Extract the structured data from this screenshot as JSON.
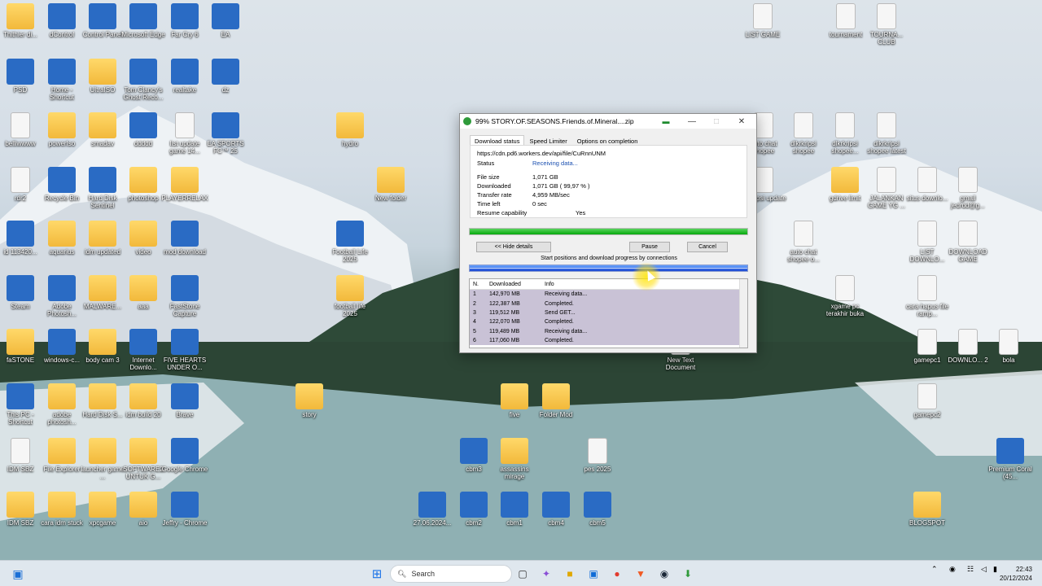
{
  "desktop_icons": [
    {
      "label": "Thithier di...",
      "kind": "folder",
      "icon": "folder-icon"
    },
    {
      "label": "dControl",
      "kind": "app",
      "icon": "app-icon"
    },
    {
      "label": "Control Panel",
      "kind": "app",
      "icon": "control-panel-icon"
    },
    {
      "label": "Microsoft Edge",
      "kind": "app",
      "icon": "edge-icon"
    },
    {
      "label": "Far Cry 6",
      "kind": "app",
      "icon": "game-icon"
    },
    {
      "label": "EA",
      "kind": "app",
      "icon": "ea-icon"
    },
    {
      "label": "LIST GAME",
      "kind": "file",
      "icon": "excel-icon"
    },
    {
      "label": "tournament",
      "kind": "file",
      "icon": "file-icon"
    },
    {
      "label": "TOURNA... CLUB",
      "kind": "file",
      "icon": "file-icon"
    },
    {
      "label": "PSD",
      "kind": "app",
      "icon": "photoshop-icon"
    },
    {
      "label": "Home - Shortcut",
      "kind": "app",
      "icon": "home-icon"
    },
    {
      "label": "UltraISO",
      "kind": "folder",
      "icon": "folder-icon"
    },
    {
      "label": "Tom Clancy's Ghost Reco...",
      "kind": "app",
      "icon": "game-icon"
    },
    {
      "label": "realtake",
      "kind": "app",
      "icon": "app-icon"
    },
    {
      "label": "dz",
      "kind": "app",
      "icon": "app-icon"
    },
    {
      "label": "belliwwww",
      "kind": "file",
      "icon": "file-icon"
    },
    {
      "label": "powerIso",
      "kind": "folder",
      "icon": "folder-icon"
    },
    {
      "label": "smadav",
      "kind": "folder",
      "icon": "folder-icon"
    },
    {
      "label": "ddddd",
      "kind": "app",
      "icon": "app-icon"
    },
    {
      "label": "list update game 14...",
      "kind": "file",
      "icon": "excel-icon"
    },
    {
      "label": "EA SPORTS FC™ 25",
      "kind": "app",
      "icon": "game-icon"
    },
    {
      "label": "hydro",
      "kind": "folder",
      "icon": "folder-icon"
    },
    {
      "label": "rdr2",
      "kind": "file",
      "icon": "file-icon"
    },
    {
      "label": "Recycle Bin",
      "kind": "app",
      "icon": "recycle-bin-icon"
    },
    {
      "label": "Hard Disk Sentinel",
      "kind": "app",
      "icon": "app-icon"
    },
    {
      "label": "photoshop",
      "kind": "folder",
      "icon": "folder-icon"
    },
    {
      "label": "PLAYERRELAX",
      "kind": "folder",
      "icon": "folder-icon"
    },
    {
      "label": "New folder",
      "kind": "folder",
      "icon": "folder-icon"
    },
    {
      "label": "id 113420...",
      "kind": "app",
      "icon": "app-icon"
    },
    {
      "label": "aquarius",
      "kind": "folder",
      "icon": "folder-icon"
    },
    {
      "label": "idm updated",
      "kind": "folder",
      "icon": "folder-icon"
    },
    {
      "label": "video",
      "kind": "folder",
      "icon": "folder-icon"
    },
    {
      "label": "mod download",
      "kind": "app",
      "icon": "app-icon"
    },
    {
      "label": "Football Life 2025",
      "kind": "app",
      "icon": "game-icon"
    },
    {
      "label": "Steam",
      "kind": "app",
      "icon": "steam-icon"
    },
    {
      "label": "Adobe Photosh...",
      "kind": "app",
      "icon": "photoshop-icon"
    },
    {
      "label": "MALWARE...",
      "kind": "folder",
      "icon": "folder-icon"
    },
    {
      "label": "aaa",
      "kind": "folder",
      "icon": "folder-icon"
    },
    {
      "label": "FastStone Capture",
      "kind": "app",
      "icon": "app-icon"
    },
    {
      "label": "football life 2025",
      "kind": "folder",
      "icon": "folder-icon"
    },
    {
      "label": "faSTONE",
      "kind": "folder",
      "icon": "folder-icon"
    },
    {
      "label": "windows-c...",
      "kind": "app",
      "icon": "app-icon"
    },
    {
      "label": "body cam 3",
      "kind": "folder",
      "icon": "folder-icon"
    },
    {
      "label": "Internet Downlo...",
      "kind": "app",
      "icon": "idm-icon"
    },
    {
      "label": "FIVE HEARTS UNDER O...",
      "kind": "app",
      "icon": "game-icon"
    },
    {
      "label": "This PC - Shortcut",
      "kind": "app",
      "icon": "monitor-icon"
    },
    {
      "label": "adobe photosh...",
      "kind": "folder",
      "icon": "folder-icon"
    },
    {
      "label": "Hard Disk S...",
      "kind": "folder",
      "icon": "folder-icon"
    },
    {
      "label": "idm build 20",
      "kind": "folder",
      "icon": "folder-icon"
    },
    {
      "label": "Brave",
      "kind": "app",
      "icon": "brave-icon"
    },
    {
      "label": "story",
      "kind": "folder",
      "icon": "folder-icon"
    },
    {
      "label": "five",
      "kind": "folder",
      "icon": "folder-icon"
    },
    {
      "label": "Folder Mod",
      "kind": "folder",
      "icon": "folder-icon"
    },
    {
      "label": "IDM SBZ",
      "kind": "file",
      "icon": "file-icon"
    },
    {
      "label": "File Explorer",
      "kind": "folder",
      "icon": "file-explorer-icon"
    },
    {
      "label": "launcher game ...",
      "kind": "folder",
      "icon": "folder-icon"
    },
    {
      "label": "SOFTWARE2 UNTUK G...",
      "kind": "folder",
      "icon": "folder-icon"
    },
    {
      "label": "Google Chrome",
      "kind": "app",
      "icon": "chrome-icon"
    },
    {
      "label": "cbm3",
      "kind": "app",
      "icon": "app-icon"
    },
    {
      "label": "assassins mirage",
      "kind": "folder",
      "icon": "folder-icon"
    },
    {
      "label": "pes 2025",
      "kind": "file",
      "icon": "file-icon"
    },
    {
      "label": "IDM SBZ",
      "kind": "folder",
      "icon": "folder-icon"
    },
    {
      "label": "cara idm stuck",
      "kind": "folder",
      "icon": "folder-icon"
    },
    {
      "label": "xpcgame",
      "kind": "folder",
      "icon": "folder-icon"
    },
    {
      "label": "aio",
      "kind": "folder",
      "icon": "folder-icon"
    },
    {
      "label": "Jeffry - Chrome",
      "kind": "app",
      "icon": "chrome-icon"
    },
    {
      "label": "27.06.2024...",
      "kind": "app",
      "icon": "app-icon"
    },
    {
      "label": "cbm2",
      "kind": "app",
      "icon": "app-icon"
    },
    {
      "label": "cbm1",
      "kind": "app",
      "icon": "app-icon"
    },
    {
      "label": "cbm4",
      "kind": "app",
      "icon": "app-icon"
    },
    {
      "label": "cbm5",
      "kind": "app",
      "icon": "app-icon"
    },
    {
      "label": "auto chat shopee",
      "kind": "file",
      "icon": "file-icon"
    },
    {
      "label": "dlkrkripsi shopee",
      "kind": "file",
      "icon": "file-icon"
    },
    {
      "label": "dlkrkripsi shopee...",
      "kind": "file",
      "icon": "file-icon"
    },
    {
      "label": "dlkrkripsi shopee latest",
      "kind": "file",
      "icon": "file-icon"
    },
    {
      "label": "dlkrkipsi update",
      "kind": "file",
      "icon": "file-icon"
    },
    {
      "label": "gdrive limit",
      "kind": "folder",
      "icon": "folder-icon"
    },
    {
      "label": "JALANKAN GAME YG ...",
      "kind": "file",
      "icon": "file-icon"
    },
    {
      "label": "situs downlo...",
      "kind": "file",
      "icon": "file-icon"
    },
    {
      "label": "gmail jedrdd@g...",
      "kind": "file",
      "icon": "file-icon"
    },
    {
      "label": "auto chat shopee o...",
      "kind": "file",
      "icon": "file-icon"
    },
    {
      "label": "LIST DOWNLO...",
      "kind": "file",
      "icon": "file-icon"
    },
    {
      "label": "DOWNLOAD GAME",
      "kind": "file",
      "icon": "file-icon"
    },
    {
      "label": "xgame pc terakhir buka",
      "kind": "file",
      "icon": "file-icon"
    },
    {
      "label": "cara hapus file ramp...",
      "kind": "file",
      "icon": "file-icon"
    },
    {
      "label": "New Text Document",
      "kind": "file",
      "icon": "file-icon"
    },
    {
      "label": "gamepc1",
      "kind": "file",
      "icon": "file-icon"
    },
    {
      "label": "DOWNLO... 2",
      "kind": "file",
      "icon": "file-icon"
    },
    {
      "label": "bola",
      "kind": "file",
      "icon": "file-icon"
    },
    {
      "label": "gamepc2",
      "kind": "file",
      "icon": "file-icon"
    },
    {
      "label": "Premium Coral (45...",
      "kind": "app",
      "icon": "app-icon"
    },
    {
      "label": "BLOGSPOT",
      "kind": "folder",
      "icon": "folder-icon"
    }
  ],
  "window": {
    "title": "99% STORY.OF.SEASONS.Friends.of.Mineral....zip",
    "tabs": [
      "Download status",
      "Speed Limiter",
      "Options on completion"
    ],
    "url": "https://cdn.pd6.workers.dev/api/file/CuRnnUNM",
    "status_label": "Status",
    "status_value": "Receiving data...",
    "fields": [
      {
        "label": "File size",
        "value": "1,071  GB"
      },
      {
        "label": "Downloaded",
        "value": "1,071  GB  ( 99,97 % )"
      },
      {
        "label": "Transfer rate",
        "value": "4,959  MB/sec"
      },
      {
        "label": "Time left",
        "value": "0 sec"
      },
      {
        "label": "Resume capability",
        "value": "Yes"
      }
    ],
    "progress_percent": 99.97,
    "hide_details_label": "<< Hide details",
    "pause_label": "Pause",
    "cancel_label": "Cancel",
    "connections_caption": "Start positions and download progress by connections",
    "table_headers": [
      "N.",
      "Downloaded",
      "Info"
    ],
    "connections": [
      {
        "n": "1",
        "downloaded": "142,970  MB",
        "info": "Receiving data..."
      },
      {
        "n": "2",
        "downloaded": "122,387  MB",
        "info": "Completed."
      },
      {
        "n": "3",
        "downloaded": "119,512  MB",
        "info": "Send GET..."
      },
      {
        "n": "4",
        "downloaded": "122,070  MB",
        "info": "Completed."
      },
      {
        "n": "5",
        "downloaded": "119,489  MB",
        "info": "Receiving data..."
      },
      {
        "n": "6",
        "downloaded": "117,060  MB",
        "info": "Completed."
      }
    ]
  },
  "taskbar": {
    "search_placeholder": "Search",
    "time": "22:43",
    "date": "20/12/2024"
  }
}
